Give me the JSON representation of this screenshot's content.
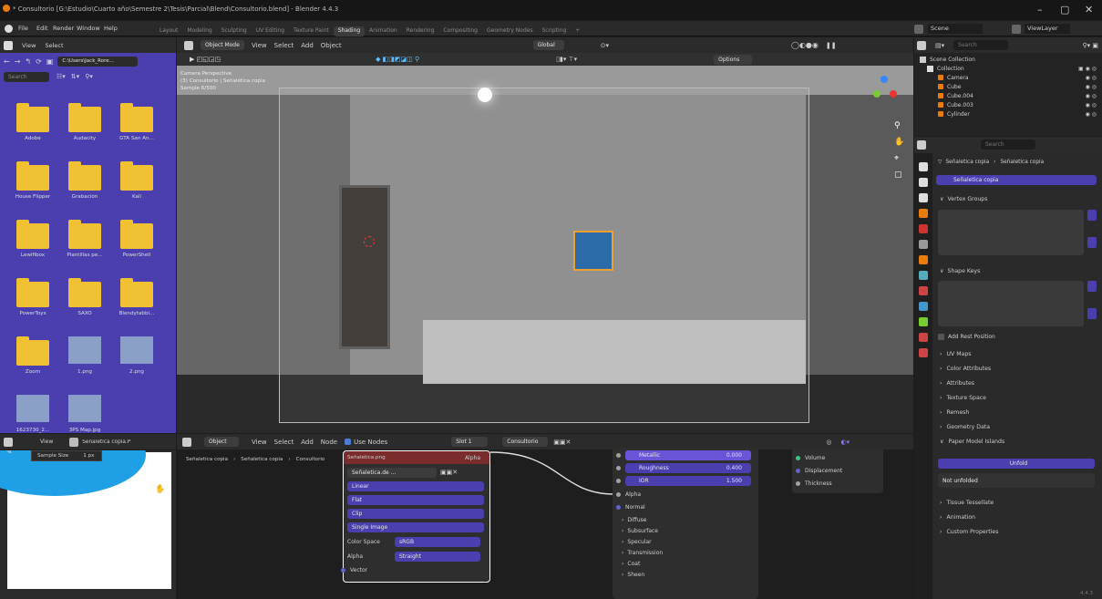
{
  "title": "* Consultorio [G:\\Estudio\\Cuarto año\\Semestre 2\\Tesis\\Parcial\\Blend\\Consultorio.blend] - Blender 4.4.3",
  "window_controls": {
    "min": "–",
    "max": "▢",
    "close": "✕"
  },
  "menu": [
    "File",
    "Edit",
    "Render",
    "Window",
    "Help"
  ],
  "workspaces": [
    "Layout",
    "Modeling",
    "Sculpting",
    "UV Editing",
    "Texture Paint",
    "Shading",
    "Animation",
    "Rendering",
    "Compositing",
    "Geometry Nodes",
    "Scripting"
  ],
  "active_workspace": "Shading",
  "topright": {
    "scene": "Scene",
    "viewlayer": "ViewLayer"
  },
  "filebrowser": {
    "header": [
      "View",
      "Select"
    ],
    "path": "C:\\Users\\Jack_Rore...",
    "search_placeholder": "Search",
    "items": [
      {
        "name": "Adobe",
        "kind": "folder"
      },
      {
        "name": "Audacity",
        "kind": "folder"
      },
      {
        "name": "GTA San An...",
        "kind": "folder"
      },
      {
        "name": "House Flipper",
        "kind": "folder"
      },
      {
        "name": "Grabación",
        "kind": "folder"
      },
      {
        "name": "Kali",
        "kind": "folder"
      },
      {
        "name": "Lewifibox",
        "kind": "folder"
      },
      {
        "name": "Plantillas pe...",
        "kind": "folder"
      },
      {
        "name": "PowerShell",
        "kind": "folder"
      },
      {
        "name": "PowerToys",
        "kind": "folder"
      },
      {
        "name": "SAXO",
        "kind": "folder"
      },
      {
        "name": "Blendytabbi...",
        "kind": "folder"
      },
      {
        "name": "Zoom",
        "kind": "folder"
      },
      {
        "name": "1.png",
        "kind": "image"
      },
      {
        "name": "2.png",
        "kind": "image"
      },
      {
        "name": "1623730_2...",
        "kind": "image"
      },
      {
        "name": "3PS Map.jpg",
        "kind": "image"
      }
    ]
  },
  "viewport": {
    "mode": "Object Mode",
    "menus": [
      "View",
      "Select",
      "Add",
      "Object"
    ],
    "global": "Global",
    "options": "Options",
    "overlay": [
      "Camera Perspective",
      "(3) Consultorio | Señalética copia",
      "Sample 6/500"
    ]
  },
  "image_editor": {
    "menus": [
      "View"
    ],
    "image": "Señaletica copia.P",
    "sample_size_label": "Sample Size",
    "sample_size_value": "1 px"
  },
  "node_editor": {
    "menus": [
      "Object",
      "View",
      "Select",
      "Add",
      "Node"
    ],
    "use_nodes": "Use Nodes",
    "slot": "Slot 1",
    "material": "Consultorio",
    "breadcrumb": [
      "Señaletica copia",
      "Señaletica copia",
      "Consultorio"
    ],
    "image_node": {
      "title": "Señaletica.png",
      "image_name": "Señaletica.de ...",
      "fields": [
        "Linear",
        "Flat",
        "Clip",
        "Single Image"
      ],
      "color_space_label": "Color Space",
      "color_space": "sRGB",
      "alpha_label": "Alpha",
      "alpha_value": "Straight",
      "output_alpha": "Alpha",
      "vector": "Vector"
    },
    "bsdf": {
      "metallic_label": "Metallic",
      "metallic": "0.000",
      "roughness_label": "Roughness",
      "roughness": "0.400",
      "ior_label": "IOR",
      "ior": "1.500",
      "alpha": "Alpha",
      "normal": "Normal",
      "sections": [
        "Diffuse",
        "Subsurface",
        "Specular",
        "Transmission",
        "Coat",
        "Sheen"
      ]
    },
    "output_node": {
      "sockets": [
        "Volume",
        "Displacement",
        "Thickness"
      ]
    }
  },
  "outliner": {
    "search_placeholder": "Search",
    "root": "Scene Collection",
    "collection": "Collection",
    "items": [
      "Camera",
      "Cube",
      "Cube.004",
      "Cube.003",
      "Cylinder"
    ]
  },
  "properties": {
    "search_placeholder": "Search",
    "breadcrumb": [
      "Señaletica copia",
      "Señaletica copia"
    ],
    "mesh_name": "Señaletica copia",
    "panels": [
      "Vertex Groups",
      "Shape Keys"
    ],
    "add_rest_position": "Add Rest Position",
    "sections": [
      "UV Maps",
      "Color Attributes",
      "Attributes",
      "Texture Space",
      "Remesh",
      "Geometry Data",
      "Paper Model Islands"
    ],
    "unfold_btn": "Unfold",
    "not_unfolded": "Not unfolded",
    "sections2": [
      "Tissue Tessellate",
      "Animation",
      "Custom Properties"
    ]
  },
  "version": "4.4.3",
  "colors": {
    "accent": "#4b3fb0",
    "folder": "#f0c233",
    "bg": "#1d1d1d",
    "selected": "#5b4fd0"
  }
}
